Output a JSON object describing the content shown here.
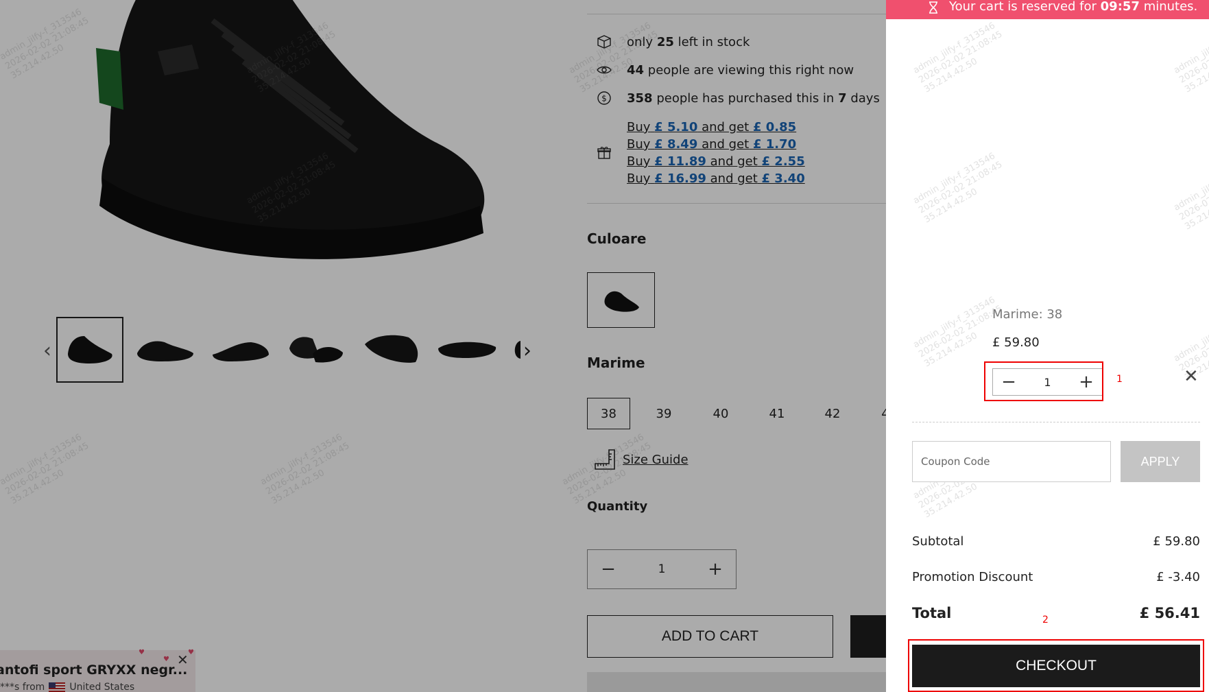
{
  "product": {
    "stock": {
      "prefix": "only",
      "count": "25",
      "suffix": "left in stock"
    },
    "viewing": {
      "count": "44",
      "suffix": "people are viewing this right now"
    },
    "purchased": {
      "count": "358",
      "middle": "people has purchased this in",
      "days": "7",
      "suffix": "days"
    },
    "promos": [
      {
        "buy": "Buy",
        "spend": "£ 5.10",
        "and": "and get",
        "save": "£ 0.85"
      },
      {
        "buy": "Buy",
        "spend": "£ 8.49",
        "and": "and get",
        "save": "£ 1.70"
      },
      {
        "buy": "Buy",
        "spend": "£ 11.89",
        "and": "and get",
        "save": "£ 2.55"
      },
      {
        "buy": "Buy",
        "spend": "£ 16.99",
        "and": "and get",
        "save": "£ 3.40"
      }
    ],
    "color_label": "Culoare",
    "size_label": "Marime",
    "sizes": [
      "38",
      "39",
      "40",
      "41",
      "42",
      "4"
    ],
    "selected_size": "38",
    "size_guide": "Size Guide",
    "quantity_label": "Quantity",
    "quantity": "1",
    "add_to_cart": "ADD TO CART"
  },
  "toast": {
    "title": "antofi sport GRYXX negr...",
    "subtitle_prefix": "***s from",
    "country": "United States"
  },
  "watermark": "admin_jilfy-f_313546\n2026-02-02 21:08:45\n35.214.42.50",
  "cart": {
    "reserve_prefix": "Your cart is reserved for",
    "reserve_time": "09:57",
    "reserve_suffix": "minutes.",
    "item": {
      "variant": "Marime: 38",
      "price": "£ 59.80",
      "quantity": "1"
    },
    "coupon_placeholder": "Coupon Code",
    "apply": "APPLY",
    "subtotal_label": "Subtotal",
    "subtotal": "£ 59.80",
    "discount_label": "Promotion Discount",
    "discount": "£ -3.40",
    "total_label": "Total",
    "total": "£ 56.41",
    "checkout": "CHECKOUT"
  },
  "annotations": {
    "qty_marker": "1",
    "checkout_marker": "2"
  }
}
